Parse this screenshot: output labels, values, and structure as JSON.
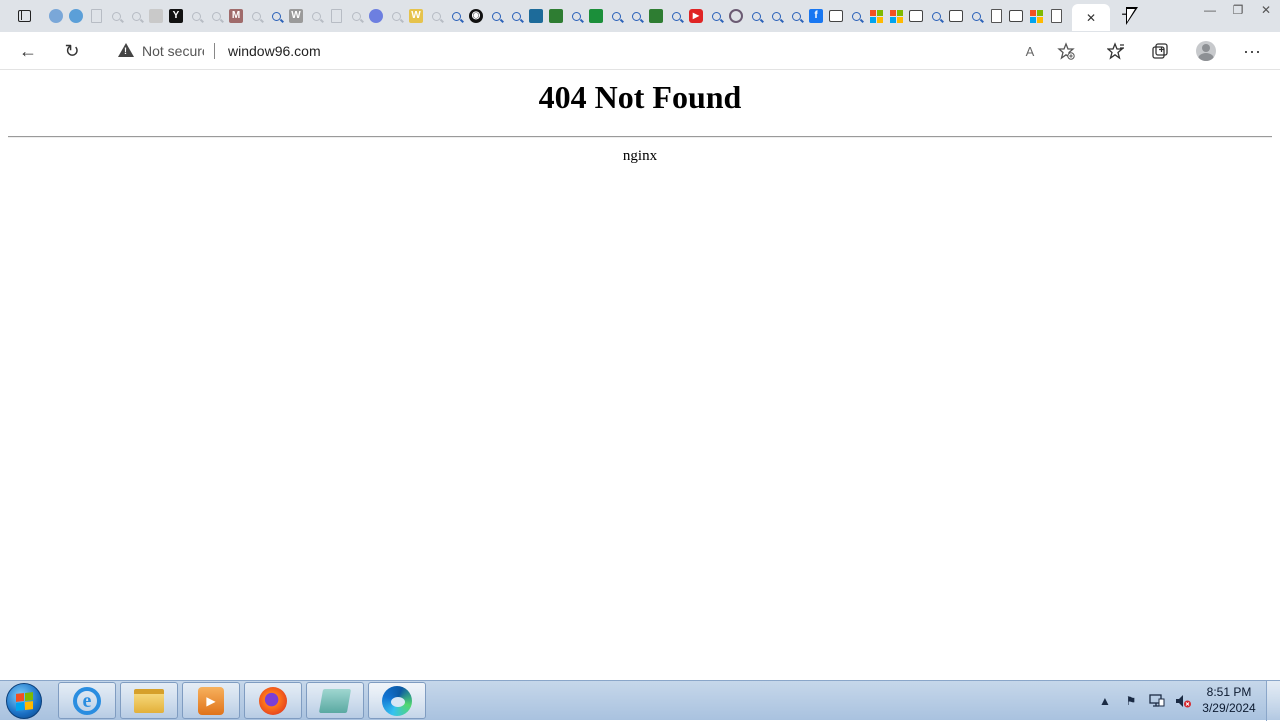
{
  "browser": {
    "tabs": [
      {
        "icon": "blue-swirl-icon",
        "color": "#7aa7d8"
      },
      {
        "icon": "edge-icon",
        "color": "#5b9fd8"
      },
      {
        "icon": "document-icon",
        "faded": true
      },
      {
        "icon": "search-icon",
        "faded": true
      },
      {
        "icon": "search-icon",
        "faded": true
      },
      {
        "icon": "windows-logo-icon",
        "color": "#c9c9c9"
      },
      {
        "icon": "yahoo-icon",
        "color": "#111111",
        "glyph": "Y"
      },
      {
        "icon": "search-icon",
        "faded": true
      },
      {
        "icon": "search-icon",
        "faded": true
      },
      {
        "icon": "gmail-icon",
        "color": "#a06b6b",
        "glyph": "M"
      },
      {
        "icon": "search-icon",
        "faded": true
      },
      {
        "icon": "search-icon"
      },
      {
        "icon": "wikipedia-icon",
        "color": "#9a9a9a",
        "glyph": "W"
      },
      {
        "icon": "search-icon",
        "faded": true
      },
      {
        "icon": "document-icon",
        "faded": true
      },
      {
        "icon": "search-icon",
        "faded": true
      },
      {
        "icon": "web-icon",
        "color": "#6d7fe0"
      },
      {
        "icon": "search-icon",
        "faded": true
      },
      {
        "icon": "word-icon",
        "color": "#e6c34c",
        "glyph": "W"
      },
      {
        "icon": "search-icon",
        "faded": true
      },
      {
        "icon": "search-icon"
      },
      {
        "icon": "clock-site-icon",
        "color": "#111111",
        "glyph": "◉"
      },
      {
        "icon": "search-icon"
      },
      {
        "icon": "search-icon"
      },
      {
        "icon": "calculator-icon",
        "color": "#1d6b9a"
      },
      {
        "icon": "minecraft-icon",
        "color": "#2e7d32"
      },
      {
        "icon": "search-icon"
      },
      {
        "icon": "grid-site-icon",
        "color": "#1b8f3a"
      },
      {
        "icon": "search-icon"
      },
      {
        "icon": "search-icon"
      },
      {
        "icon": "minecraft-icon",
        "color": "#2e7d32"
      },
      {
        "icon": "search-icon"
      },
      {
        "icon": "youtube-icon",
        "color": "#e02424",
        "glyph": "▶"
      },
      {
        "icon": "search-icon"
      },
      {
        "icon": "circle-site-icon",
        "color": "#6b5b73",
        "glyph": "○"
      },
      {
        "icon": "search-icon"
      },
      {
        "icon": "search-icon"
      },
      {
        "icon": "search-icon"
      },
      {
        "icon": "facebook-icon",
        "color": "#1877f2",
        "glyph": "f"
      },
      {
        "icon": "window-icon"
      },
      {
        "icon": "search-icon"
      },
      {
        "icon": "microsoft-icon"
      },
      {
        "icon": "microsoft-icon"
      },
      {
        "icon": "window-icon"
      },
      {
        "icon": "search-icon"
      },
      {
        "icon": "window-icon"
      },
      {
        "icon": "search-icon"
      },
      {
        "icon": "document-icon"
      },
      {
        "icon": "window-icon"
      },
      {
        "icon": "microsoft-icon"
      },
      {
        "icon": "document-icon"
      }
    ],
    "active_tab_close": "✕",
    "new_tab": "+",
    "window_controls": {
      "minimize": "—",
      "restore": "❐",
      "close": "✕"
    },
    "toolbar": {
      "back": "←",
      "refresh": "↻",
      "security_label": "Not secure",
      "url": "window96.com",
      "read_aloud": "A",
      "more": "···"
    }
  },
  "page": {
    "heading": "404 Not Found",
    "server": "nginx"
  },
  "taskbar": {
    "apps": [
      "internet-explorer-icon",
      "file-explorer-icon",
      "media-player-icon",
      "firefox-icon",
      "app-icon",
      "edge-icon"
    ],
    "clock_time": "8:51 PM",
    "clock_date": "3/29/2024",
    "ie_glyph": "e"
  }
}
